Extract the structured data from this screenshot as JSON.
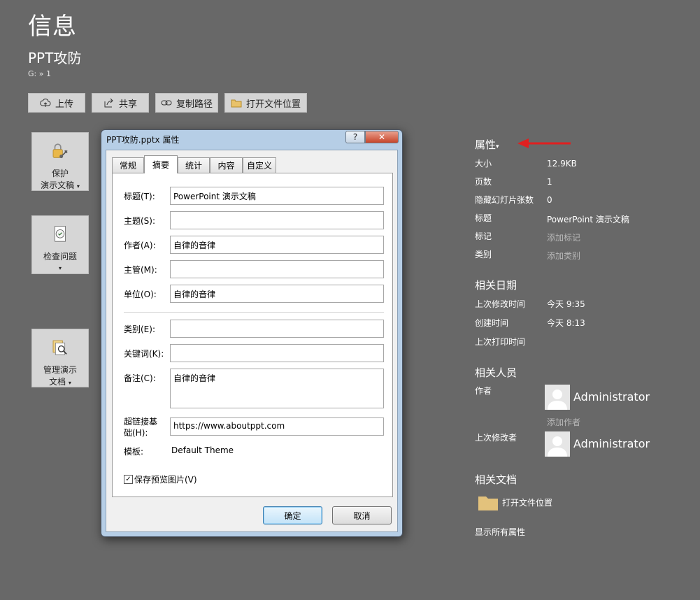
{
  "page_title": "信息",
  "doc": {
    "title": "PPT攻防",
    "path": "G: » 1"
  },
  "toolbar": [
    {
      "label": "上传",
      "icon": "cloud-upload-icon"
    },
    {
      "label": "共享",
      "icon": "share-icon"
    },
    {
      "label": "复制路径",
      "icon": "link-icon"
    },
    {
      "label": "打开文件位置",
      "icon": "folder-icon"
    }
  ],
  "tiles": {
    "protect": {
      "label1": "保护",
      "label2": "演示文稿",
      "caret": "▾"
    },
    "inspect": {
      "label1": "检查问题",
      "caret": "▾"
    },
    "manage": {
      "label1": "管理演示",
      "label2": "文档",
      "caret": "▾"
    }
  },
  "dialog": {
    "title": "PPT攻防.pptx 属性",
    "help": "?",
    "close": "✕",
    "tabs": [
      "常规",
      "摘要",
      "统计",
      "内容",
      "自定义"
    ],
    "fields": {
      "title": {
        "label": "标题(T):",
        "value": "PowerPoint 演示文稿"
      },
      "subject": {
        "label": "主题(S):",
        "value": ""
      },
      "author": {
        "label": "作者(A):",
        "value": "自律的音律"
      },
      "manager": {
        "label": "主管(M):",
        "value": ""
      },
      "company": {
        "label": "单位(O):",
        "value": "自律的音律"
      },
      "category": {
        "label": "类别(E):",
        "value": ""
      },
      "keywords": {
        "label": "关键词(K):",
        "value": ""
      },
      "comments": {
        "label": "备注(C):",
        "value": "自律的音律"
      },
      "hyperlink": {
        "label1": "超链接基",
        "label2": "础(H):",
        "value": "https://www.aboutppt.com"
      },
      "template": {
        "label": "模板:",
        "value": "Default Theme"
      }
    },
    "save_preview": {
      "label": "保存预览图片(V)",
      "checked": true,
      "mark": "✓"
    },
    "ok": "确定",
    "cancel": "取消"
  },
  "properties": {
    "heading": "属性",
    "caret": "▾",
    "rows": [
      {
        "label": "大小",
        "value": "12.9KB",
        "muted": false
      },
      {
        "label": "页数",
        "value": "1",
        "muted": false
      },
      {
        "label": "隐藏幻灯片张数",
        "value": "0",
        "muted": false
      },
      {
        "label": "标题",
        "value": "PowerPoint 演示文稿",
        "muted": false
      },
      {
        "label": "标记",
        "value": "添加标记",
        "muted": true
      },
      {
        "label": "类别",
        "value": "添加类别",
        "muted": true
      }
    ]
  },
  "dates": {
    "heading": "相关日期",
    "rows": [
      {
        "label": "上次修改时间",
        "value": "今天 9:35"
      },
      {
        "label": "创建时间",
        "value": "今天 8:13"
      },
      {
        "label": "上次打印时间",
        "value": ""
      }
    ]
  },
  "people": {
    "heading": "相关人员",
    "author_label": "作者",
    "author_name": "Administrator",
    "add_author": "添加作者",
    "modified_label": "上次修改者",
    "modified_name": "Administrator"
  },
  "related_docs": {
    "heading": "相关文档",
    "open_location": "打开文件位置",
    "show_all": "显示所有属性"
  },
  "colors": {
    "background": "#686868",
    "arrow": "#e02020",
    "dialog_frame": "#b6cee6"
  }
}
